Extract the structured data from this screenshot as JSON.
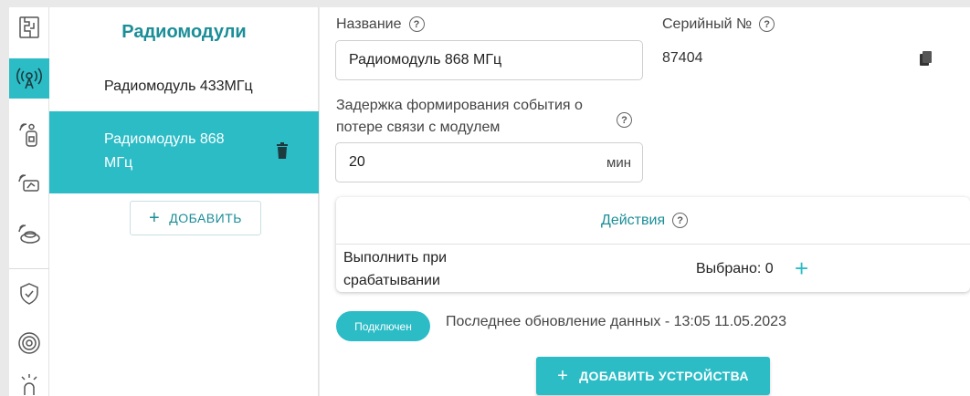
{
  "sidebar_icons": [
    {
      "name": "scheme-icon"
    },
    {
      "name": "radio-module-icon",
      "active": true
    },
    {
      "name": "remote-control-icon"
    },
    {
      "name": "wireless-sensor-icon"
    },
    {
      "name": "wireless-button-icon"
    },
    {
      "name": "shield-icon"
    },
    {
      "name": "target-icon"
    },
    {
      "name": "alarm-lamp-icon"
    }
  ],
  "modules": {
    "title": "Радиомодули",
    "items": [
      {
        "label": "Радиомодуль 433МГц",
        "selected": false
      },
      {
        "label": "Радиомодуль 868 МГц",
        "selected": true
      }
    ],
    "add_label": "ДОБАВИТЬ",
    "add_plus": "+"
  },
  "form": {
    "name_label": "Название",
    "name_value": "Радиомодуль 868 МГц",
    "serial_label": "Серийный №",
    "serial_value": "87404",
    "delay_label": "Задержка формирования события о потере связи с модулем",
    "delay_value": "20",
    "delay_unit": "мин",
    "help_glyph": "?"
  },
  "actions": {
    "title": "Действия",
    "execute_label": "Выполнить при срабатывании",
    "selected_text": "Выбрано: 0",
    "add_plus": "+"
  },
  "status": {
    "badge": "Подключен",
    "last_update": "Последнее обновление данных - 13:05 11.05.2023"
  },
  "add_devices_label": "ДОБАВИТЬ УСТРОЙСТВА",
  "add_devices_plus": "+",
  "colors": {
    "accent": "#2bbcc6",
    "accent_text": "#1b8e98"
  }
}
